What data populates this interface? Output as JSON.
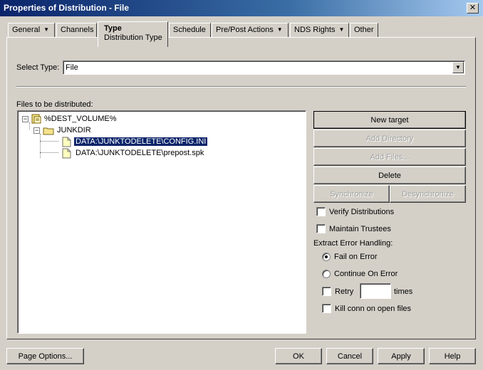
{
  "window": {
    "title": "Properties of Distribution - File",
    "close_symbol": "✕"
  },
  "tabs": [
    {
      "label": "General",
      "has_menu": true
    },
    {
      "label": "Channels",
      "has_menu": false
    },
    {
      "label": "Type",
      "sublabel": "Distribution Type",
      "active": true
    },
    {
      "label": "Schedule",
      "has_menu": false
    },
    {
      "label": "Pre/Post Actions",
      "has_menu": true
    },
    {
      "label": "NDS Rights",
      "has_menu": true
    },
    {
      "label": "Other",
      "has_menu": false
    }
  ],
  "select_type": {
    "label": "Select Type:",
    "value": "File"
  },
  "files": {
    "label": "Files to be distributed:",
    "tree": [
      {
        "label": "%DEST_VOLUME%",
        "icon": "volume-icon",
        "expanded": true
      },
      {
        "label": "JUNKDIR",
        "icon": "folder-icon",
        "expanded": true
      },
      {
        "label": "DATA:\\JUNKTODELETE\\CONFIG.INI",
        "icon": "file-icon",
        "selected": true
      },
      {
        "label": "DATA:\\JUNKTODELETE\\prepost.spk",
        "icon": "file-icon",
        "selected": false
      }
    ]
  },
  "actions": {
    "new_target": "New target",
    "add_directory": "Add Directory",
    "add_files": "Add Files...",
    "delete": "Delete",
    "synchronize": "Synchronize",
    "desynchronize": "Desynchronize"
  },
  "options": {
    "verify_distributions": {
      "label": "Verify Distributions",
      "checked": false
    },
    "maintain_trustees": {
      "label": "Maintain Trustees",
      "checked": false
    },
    "extract_error_label": "Extract Error Handling:",
    "fail_on_error": {
      "label": "Fail on Error",
      "checked": true
    },
    "continue_on_error": {
      "label": "Continue On Error",
      "checked": false
    },
    "retry": {
      "label": "Retry",
      "checked": false,
      "value": "",
      "suffix": "times"
    },
    "kill_conn": {
      "label": "Kill conn on open files",
      "checked": false
    }
  },
  "footer": {
    "page_options": "Page Options...",
    "ok": "OK",
    "cancel": "Cancel",
    "apply": "Apply",
    "help": "Help"
  },
  "colors": {
    "titlebar_start": "#0a246a",
    "selection": "#0a246a",
    "face": "#d4d0c8"
  }
}
